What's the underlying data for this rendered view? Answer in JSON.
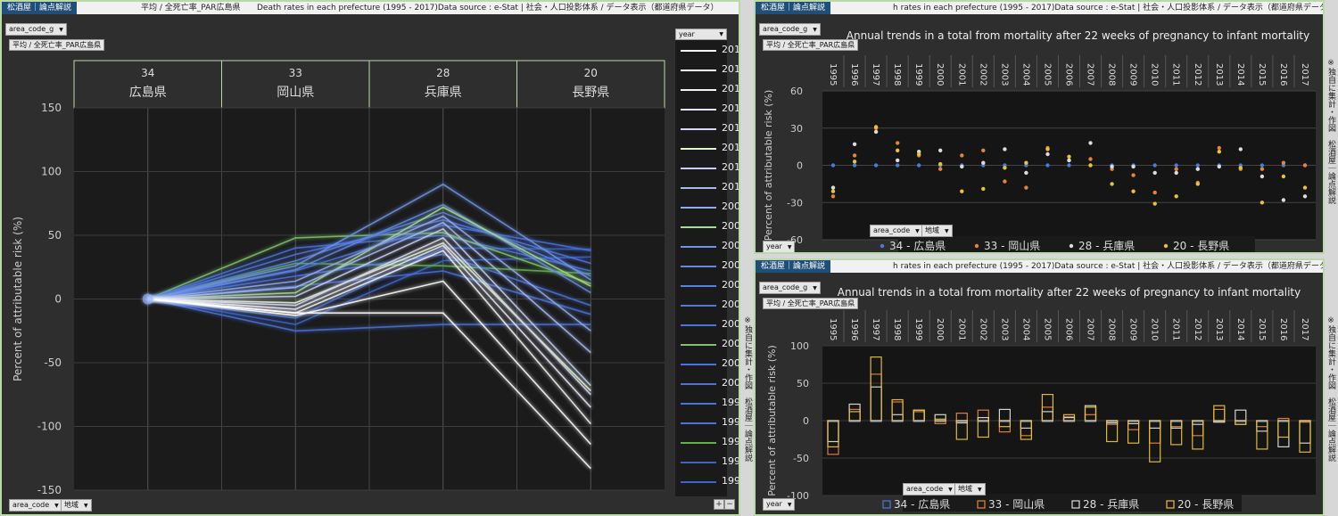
{
  "left": {
    "brand": "松酒屋｜論点解説",
    "breadcrumb": "平均 / 全死亡率_PAR広島県",
    "title": "Death rates in each prefecture (1995 - 2017)Data source : e-Stat | 社会・人口投影体系 / データ表示（都道府県データ）",
    "filter_chip": "area_code_g",
    "measure_chip": "平均 / 全死亡率_PAR広島県",
    "bottom_chip1": "area_code",
    "bottom_chip2": "地域",
    "legend_header": "year",
    "plus": "+",
    "minus": "−"
  },
  "chart_data": [
    {
      "type": "line",
      "ylabel": "Percent of attributable risk (%)",
      "ylim": [
        -150,
        150
      ],
      "yticks": [
        -150,
        -100,
        -50,
        0,
        50,
        100,
        150
      ],
      "categories": [
        {
          "code": "34",
          "name": "広島県"
        },
        {
          "code": "33",
          "name": "岡山県"
        },
        {
          "code": "28",
          "name": "兵庫県"
        },
        {
          "code": "20",
          "name": "長野県"
        }
      ],
      "legend_years": [
        "2017",
        "2016",
        "2015",
        "2014",
        "2013",
        "2012",
        "2011",
        "2010",
        "2009",
        "2008",
        "2007",
        "2006",
        "2005",
        "2004",
        "2003",
        "2002",
        "2001",
        "2000",
        "1999",
        "1998",
        "1997",
        "1996",
        "1995"
      ],
      "year_colors": {
        "2017": "#ffffff",
        "2016": "#ffffff",
        "2015": "#f4f4f4",
        "2014": "#e6e6f8",
        "2013": "#d6d8f6",
        "2012": "#e4f4cc",
        "2011": "#c6d0f2",
        "2010": "#a6baf0",
        "2009": "#94aaec",
        "2008": "#a6dc8c",
        "2007": "#6f93e6",
        "2006": "#6388e2",
        "2005": "#5a81e0",
        "2004": "#4f77dc",
        "2003": "#4a72d8",
        "2002": "#7ec36b",
        "2001": "#4a72d8",
        "2000": "#4a72d8",
        "1999": "#4a72d8",
        "1998": "#4a72d8",
        "1997": "#62b04f",
        "1996": "#3e64cc",
        "1995": "#3e64cc"
      },
      "series": [
        {
          "name": "2017",
          "values": [
            0,
            -11,
            -11,
            -133
          ]
        },
        {
          "name": "2016",
          "values": [
            0,
            -13,
            14,
            -114
          ]
        },
        {
          "name": "2015",
          "values": [
            0,
            -11,
            38,
            -98
          ]
        },
        {
          "name": "2014",
          "values": [
            0,
            -8,
            42,
            -85
          ]
        },
        {
          "name": "2013",
          "values": [
            0,
            -5,
            48,
            -75
          ]
        },
        {
          "name": "2012",
          "values": [
            0,
            -3,
            44,
            -72
          ]
        },
        {
          "name": "2011",
          "values": [
            0,
            2,
            55,
            -68
          ]
        },
        {
          "name": "2010",
          "values": [
            0,
            9,
            60,
            -42
          ]
        },
        {
          "name": "2009",
          "values": [
            0,
            14,
            65,
            -25
          ]
        },
        {
          "name": "2008",
          "values": [
            0,
            5,
            72,
            10
          ]
        },
        {
          "name": "2007",
          "values": [
            0,
            26,
            90,
            15
          ]
        },
        {
          "name": "2006",
          "values": [
            0,
            23,
            74,
            5
          ]
        },
        {
          "name": "2005",
          "values": [
            0,
            30,
            68,
            18
          ]
        },
        {
          "name": "2004",
          "values": [
            0,
            35,
            62,
            28
          ]
        },
        {
          "name": "2003",
          "values": [
            0,
            22,
            58,
            38
          ]
        },
        {
          "name": "2002",
          "values": [
            0,
            48,
            52,
            12
          ]
        },
        {
          "name": "2001",
          "values": [
            0,
            40,
            50,
            22
          ]
        },
        {
          "name": "2000",
          "values": [
            0,
            -25,
            -20,
            -20
          ]
        },
        {
          "name": "1999",
          "values": [
            0,
            18,
            35,
            -5
          ]
        },
        {
          "name": "1998",
          "values": [
            0,
            10,
            22,
            -12
          ]
        },
        {
          "name": "1997",
          "values": [
            0,
            28,
            26,
            20
          ]
        },
        {
          "name": "1996",
          "values": [
            0,
            -15,
            40,
            39
          ]
        },
        {
          "name": "1995",
          "values": [
            0,
            -20,
            30,
            33
          ]
        }
      ]
    },
    {
      "type": "scatter",
      "title": "Annual trends in a total from mortality after 22 weeks of pregnancy to infant mortality",
      "ylabel": "Percent of attributable risk (%)",
      "ylim": [
        -60,
        60
      ],
      "yticks": [
        -60,
        -30,
        0,
        30,
        60
      ],
      "x": [
        "1995",
        "1996",
        "1997",
        "1998",
        "1999",
        "2000",
        "2001",
        "2002",
        "2003",
        "2004",
        "2005",
        "2006",
        "2007",
        "2008",
        "2009",
        "2010",
        "2011",
        "2012",
        "2013",
        "2014",
        "2015",
        "2016",
        "2017"
      ],
      "series": [
        {
          "name": "34 - 広島県",
          "color": "#4a7bd8",
          "values": [
            0,
            0,
            0,
            0,
            0,
            0,
            0,
            0,
            0,
            0,
            0,
            0,
            0,
            0,
            0,
            0,
            0,
            0,
            0,
            0,
            0,
            0,
            0
          ]
        },
        {
          "name": "33 - 岡山県",
          "color": "#e8823a",
          "values": [
            -25,
            8,
            30,
            18,
            8,
            -3,
            8,
            12,
            -13,
            -18,
            14,
            4,
            5,
            -3,
            -8,
            -22,
            -3,
            -14,
            14,
            -3,
            -3,
            2,
            0
          ]
        },
        {
          "name": "28 - 兵庫県",
          "color": "#dcdcdc",
          "values": [
            -18,
            17,
            27,
            4,
            11,
            12,
            -1,
            2,
            13,
            -6,
            9,
            4,
            18,
            -1,
            -1,
            -6,
            -6,
            -3,
            -1,
            13,
            -9,
            -28,
            -25
          ]
        },
        {
          "name": "20 - 長野県",
          "color": "#e8c23a",
          "values": [
            -21,
            3,
            31,
            12,
            9,
            1,
            -21,
            -19,
            -2,
            2,
            13,
            7,
            0,
            -15,
            -21,
            -31,
            -25,
            -15,
            11,
            -2,
            -30,
            -9,
            -18
          ]
        }
      ]
    },
    {
      "type": "bar",
      "title": "Annual trends in a total from mortality after 22 weeks of pregnancy to infant mortality",
      "ylabel": "Percent of attributable risk (%)",
      "ylim": [
        -100,
        100
      ],
      "yticks": [
        -100,
        -50,
        0,
        50,
        100
      ],
      "x": [
        "1995",
        "1996",
        "1997",
        "1998",
        "1999",
        "2000",
        "2001",
        "2002",
        "2003",
        "2004",
        "2005",
        "2006",
        "2007",
        "2008",
        "2009",
        "2010",
        "2011",
        "2012",
        "2013",
        "2014",
        "2015",
        "2016",
        "2017"
      ],
      "series": [
        {
          "name": "34 - 広島県",
          "color": "#4a7bd8",
          "values": [
            0,
            0,
            0,
            0,
            0,
            0,
            0,
            0,
            0,
            0,
            0,
            0,
            0,
            0,
            0,
            0,
            0,
            0,
            0,
            0,
            0,
            0,
            0
          ]
        },
        {
          "name": "33 - 岡山県",
          "color": "#e8823a",
          "values": [
            -45,
            15,
            62,
            25,
            12,
            -4,
            10,
            14,
            -15,
            -20,
            18,
            5,
            8,
            -5,
            -12,
            -30,
            -8,
            -20,
            15,
            -5,
            -8,
            3,
            -2
          ]
        },
        {
          "name": "28 - 兵庫県",
          "color": "#dcdcdc",
          "values": [
            -28,
            22,
            45,
            8,
            14,
            8,
            -3,
            4,
            15,
            -10,
            12,
            4,
            20,
            -3,
            -4,
            -10,
            -10,
            -5,
            -2,
            14,
            -14,
            -35,
            -30
          ]
        },
        {
          "name": "20 - 長野県",
          "color": "#e8c23a",
          "values": [
            -35,
            12,
            85,
            28,
            14,
            2,
            -25,
            -22,
            -8,
            -25,
            35,
            8,
            18,
            -28,
            -30,
            -55,
            -32,
            -38,
            20,
            -5,
            -38,
            -22,
            -42
          ]
        }
      ]
    }
  ],
  "right_top": {
    "brand": "松酒屋｜論点解説",
    "title": "h rates in each prefecture (1995 - 2017)Data source : e-Stat | 社会・人口投影体系 / データ表示（都道府県データ）",
    "filter_chip": "area_code_g",
    "measure_chip": "平均 / 全死亡率_PAR広島県",
    "chip_area": "area_code",
    "chip_region": "地域",
    "chip_year": "year",
    "side_note": "※独自に集計・作図　松酒屋｜論点解説"
  },
  "right_bottom": {
    "brand": "松酒屋｜論点解説",
    "title": "h rates in each prefecture (1995 - 2017)Data source : e-Stat | 社会・人口投影体系 / データ表示（都道府県データ）",
    "filter_chip": "area_code_g",
    "measure_chip": "平均 / 全死亡率_PAR広島県",
    "chip_area": "area_code",
    "chip_region": "地域",
    "chip_year": "year",
    "side_note": "※独自に集計・作図　松酒屋｜論点解説",
    "center_note": "※独自に集計・作図　松酒屋｜論点解説"
  }
}
